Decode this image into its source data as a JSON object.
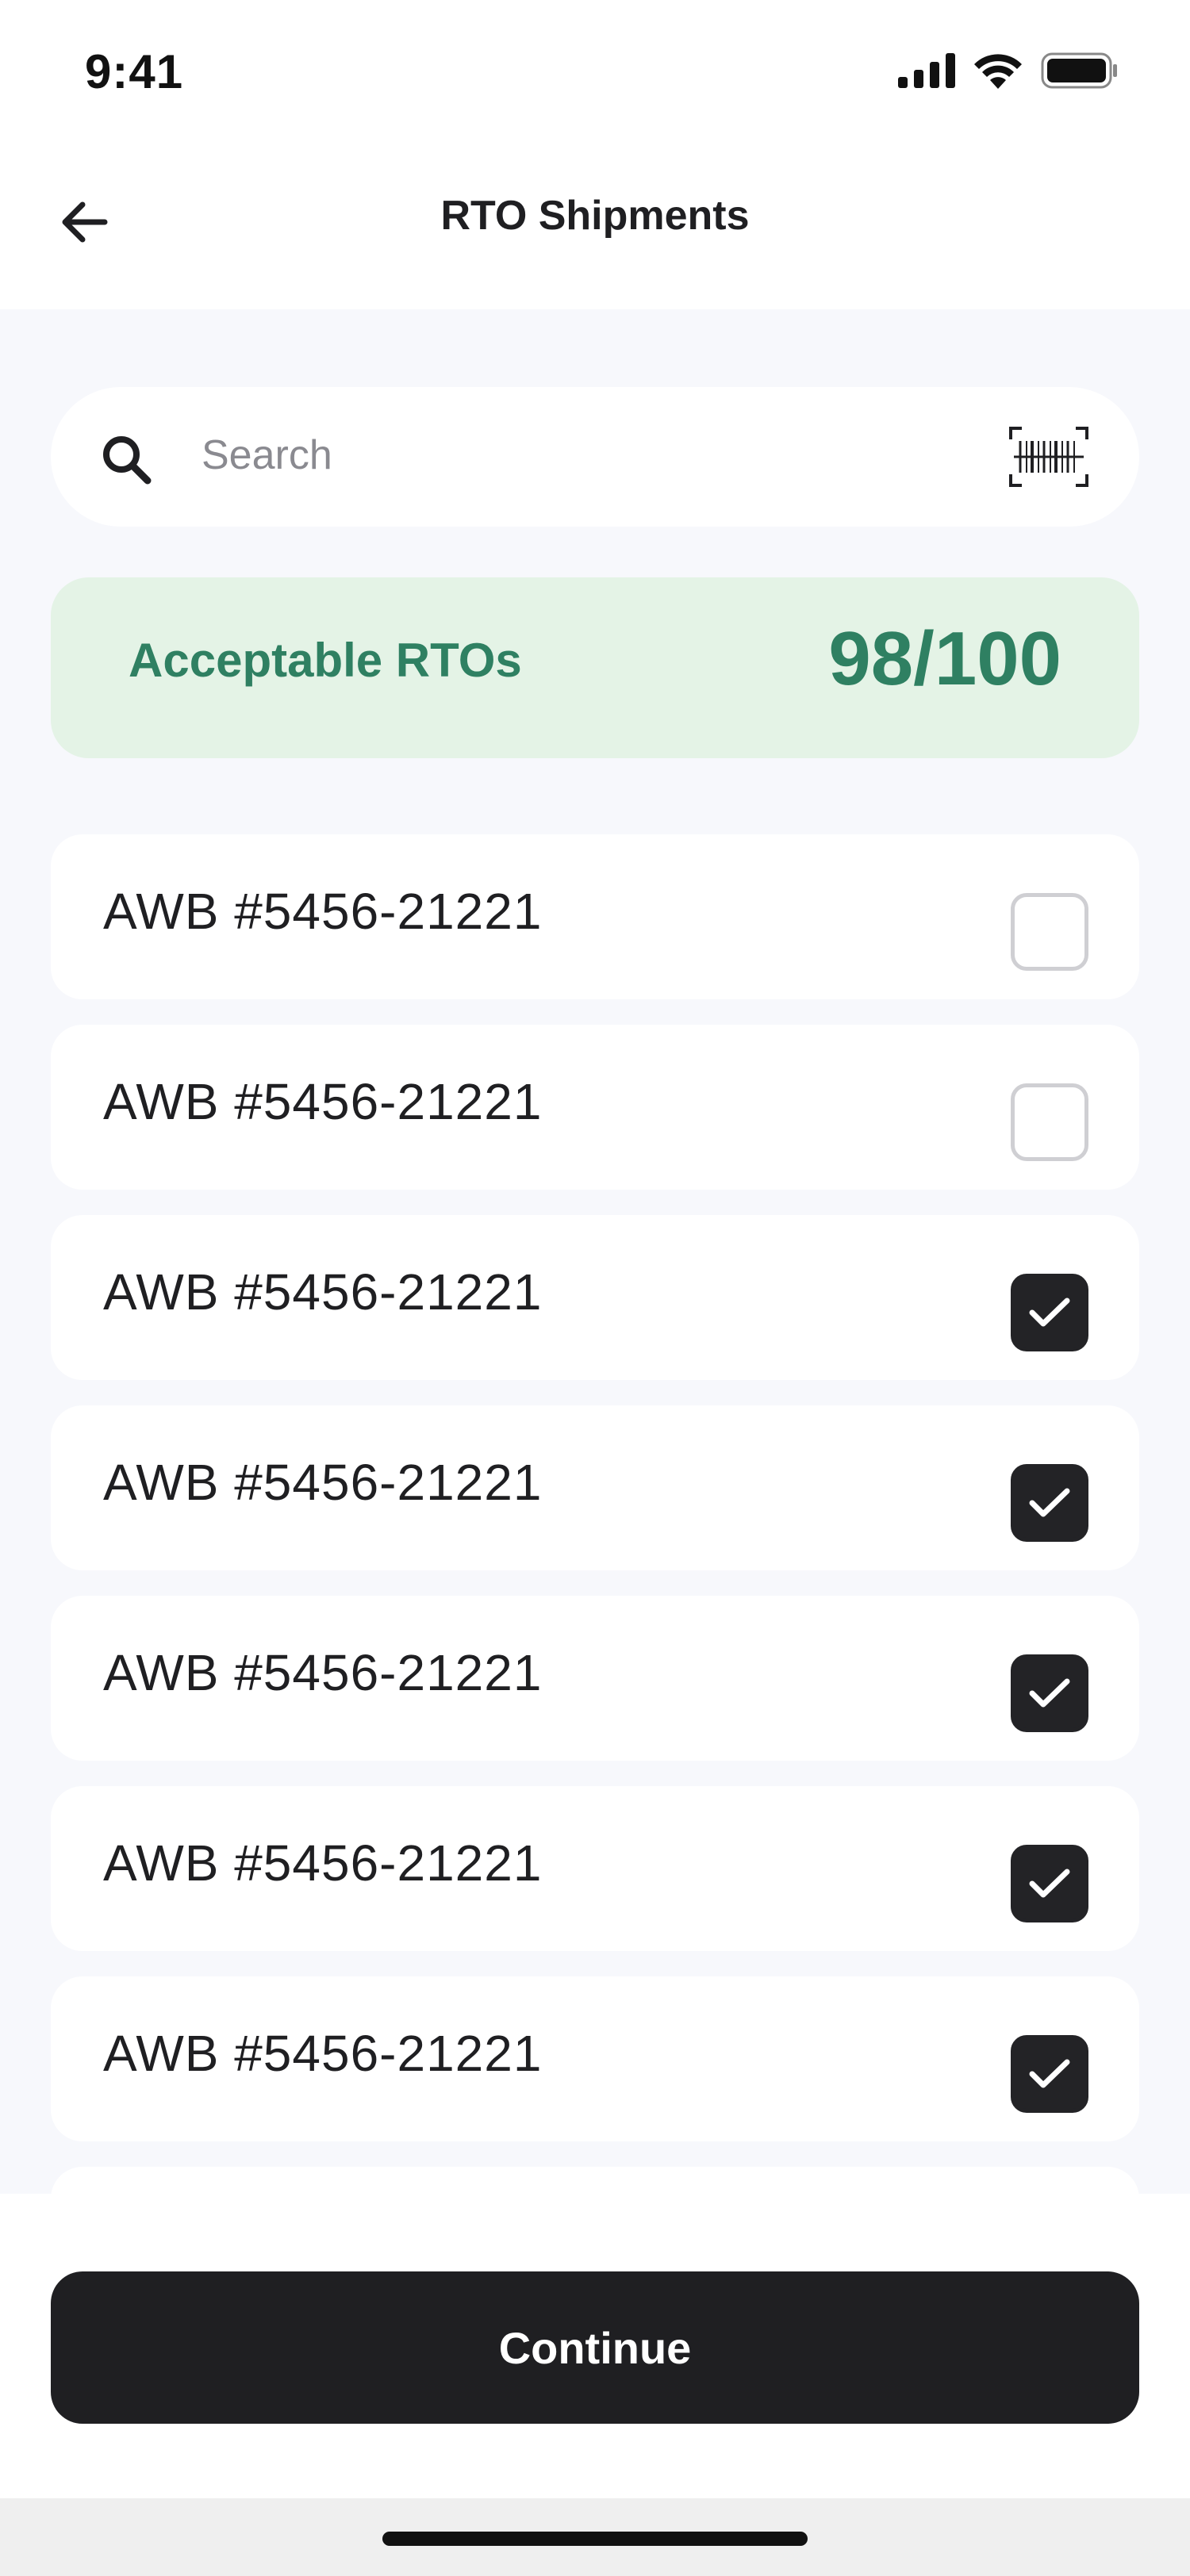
{
  "status_bar": {
    "time": "9:41"
  },
  "header": {
    "title": "RTO Shipments"
  },
  "search": {
    "placeholder": "Search",
    "value": ""
  },
  "summary": {
    "label": "Acceptable RTOs",
    "count": "98/100"
  },
  "shipments": [
    {
      "label": "AWB #5456-21221",
      "checked": false
    },
    {
      "label": "AWB #5456-21221",
      "checked": false
    },
    {
      "label": "AWB #5456-21221",
      "checked": true
    },
    {
      "label": "AWB #5456-21221",
      "checked": true
    },
    {
      "label": "AWB #5456-21221",
      "checked": true
    },
    {
      "label": "AWB #5456-21221",
      "checked": true
    },
    {
      "label": "AWB #5456-21221",
      "checked": true
    },
    {
      "label": "",
      "checked": false
    }
  ],
  "footer": {
    "continue_label": "Continue"
  },
  "colors": {
    "accent_green": "#2f8062",
    "banner_bg": "#e4f3e6",
    "dark": "#1f1f22",
    "page_bg": "#f7f8fc"
  },
  "icons": {
    "back": "arrow-left-icon",
    "search": "search-icon",
    "scan": "barcode-scan-icon",
    "check": "checkmark-icon"
  }
}
